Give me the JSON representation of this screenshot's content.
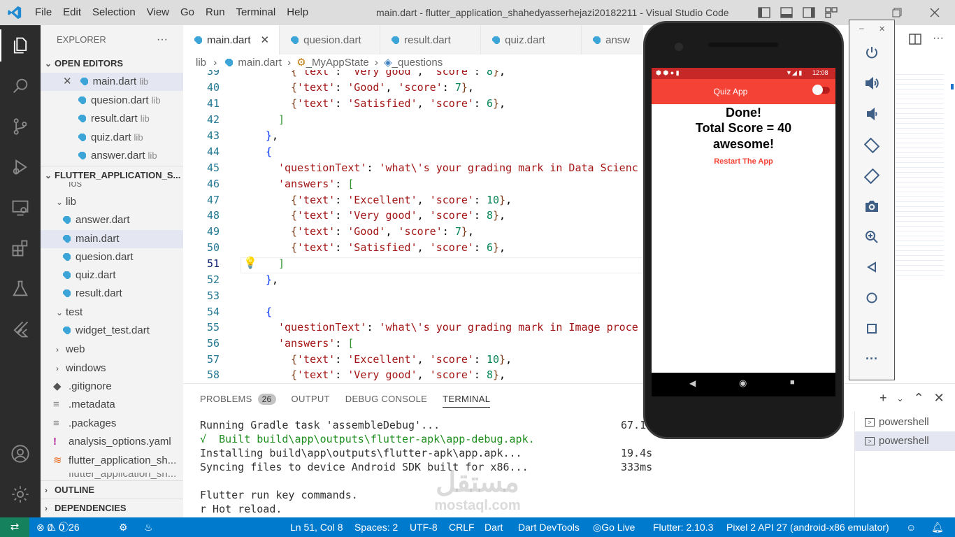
{
  "titlebar": {
    "menu": [
      "File",
      "Edit",
      "Selection",
      "View",
      "Go",
      "Run",
      "Terminal",
      "Help"
    ],
    "title": "main.dart - flutter_application_shahedyasserhejazi20182211 - Visual Studio Code"
  },
  "sidebar": {
    "header": "EXPLORER",
    "open_editors_label": "OPEN EDITORS",
    "open_editors": [
      {
        "name": "main.dart",
        "dir": "lib"
      },
      {
        "name": "quesion.dart",
        "dir": "lib"
      },
      {
        "name": "result.dart",
        "dir": "lib"
      },
      {
        "name": "quiz.dart",
        "dir": "lib"
      },
      {
        "name": "answer.dart",
        "dir": "lib"
      }
    ],
    "project_label": "FLUTTER_APPLICATION_S...",
    "tree": {
      "ios": "ios",
      "lib": "lib",
      "lib_files": [
        "answer.dart",
        "main.dart",
        "quesion.dart",
        "quiz.dart",
        "result.dart"
      ],
      "test": "test",
      "test_files": [
        "widget_test.dart"
      ],
      "web": "web",
      "windows": "windows",
      "files": [
        ".gitignore",
        ".metadata",
        ".packages",
        "analysis_options.yaml",
        "flutter_application_sh...",
        "flutter_application_sh..."
      ]
    },
    "outline_label": "OUTLINE",
    "dependencies_label": "DEPENDENCIES"
  },
  "tabs": [
    "main.dart",
    "quesion.dart",
    "result.dart",
    "quiz.dart",
    "answ"
  ],
  "breadcrumb": {
    "a": "lib",
    "b": "main.dart",
    "c": "_MyAppState",
    "d": "_questions"
  },
  "editor": {
    "lines": [
      {
        "num": "39",
        "code": "{'text': 'Very good', 'score': 8},"
      },
      {
        "num": "40"
      },
      {
        "num": "41"
      },
      {
        "num": "42"
      },
      {
        "num": "43"
      },
      {
        "num": "44"
      },
      {
        "num": "45"
      },
      {
        "num": "46"
      },
      {
        "num": "47"
      },
      {
        "num": "48"
      },
      {
        "num": "49"
      },
      {
        "num": "50"
      },
      {
        "num": "51"
      },
      {
        "num": "52"
      },
      {
        "num": "53"
      },
      {
        "num": "54"
      },
      {
        "num": "55"
      },
      {
        "num": "56"
      },
      {
        "num": "57"
      },
      {
        "num": "58"
      }
    ],
    "strings": {
      "qt_key": "'questionText'",
      "ans_key": "'answers'",
      "text_key": "'text'",
      "score_key": "'score'",
      "excellent": "'Excellent'",
      "very_good": "'Very good'",
      "good": "'Good'",
      "satisfied": "'Satisfied'",
      "q_ds": "'what\\'s your grading mark in Data Scienc",
      "q_ip": "'what\\'s your grading mark in Image proce",
      "v10": "10",
      "v8": "8",
      "v7": "7",
      "v6": "6"
    }
  },
  "panel": {
    "tabs": [
      "PROBLEMS",
      "OUTPUT",
      "DEBUG CONSOLE",
      "TERMINAL"
    ],
    "problems_count": "26",
    "terminal": [
      {
        "text": "Running Gradle task 'assembleDebug'...",
        "time": "67.1"
      },
      {
        "text": "√  Built build\\app\\outputs\\flutter-apk\\app-debug.apk.",
        "time": ""
      },
      {
        "text": "Installing build\\app\\outputs\\flutter-apk\\app.apk...",
        "time": "19.4s"
      },
      {
        "text": "Syncing files to device Android SDK built for x86...",
        "time": "333ms"
      },
      {
        "text": "",
        "time": ""
      },
      {
        "text": "Flutter run key commands.",
        "time": ""
      },
      {
        "text": "r Hot reload.",
        "time": ""
      }
    ],
    "shells": [
      "powershell",
      "powershell"
    ]
  },
  "status": {
    "errors": "0",
    "warnings": "0",
    "infos": "26",
    "position": "Ln 51, Col 8",
    "spaces": "Spaces: 2",
    "encoding": "UTF-8",
    "eol": "CRLF",
    "language": "Dart",
    "devtools": "Dart DevTools",
    "golive": "Go Live",
    "flutter": "Flutter: 2.10.3",
    "device": "Pixel 2 API 27 (android-x86 emulator)"
  },
  "phone": {
    "time": "12:08",
    "app_title": "Quiz App",
    "done": "Done!",
    "score": "Total Score = 40",
    "verdict": "awesome!",
    "restart": "Restart The App"
  },
  "watermark": {
    "arabic": "مستقل",
    "latin": "mostaql.com"
  },
  "colors": {
    "accent": "#007acc",
    "appbar": "#f44336",
    "restart": "#f44336"
  }
}
